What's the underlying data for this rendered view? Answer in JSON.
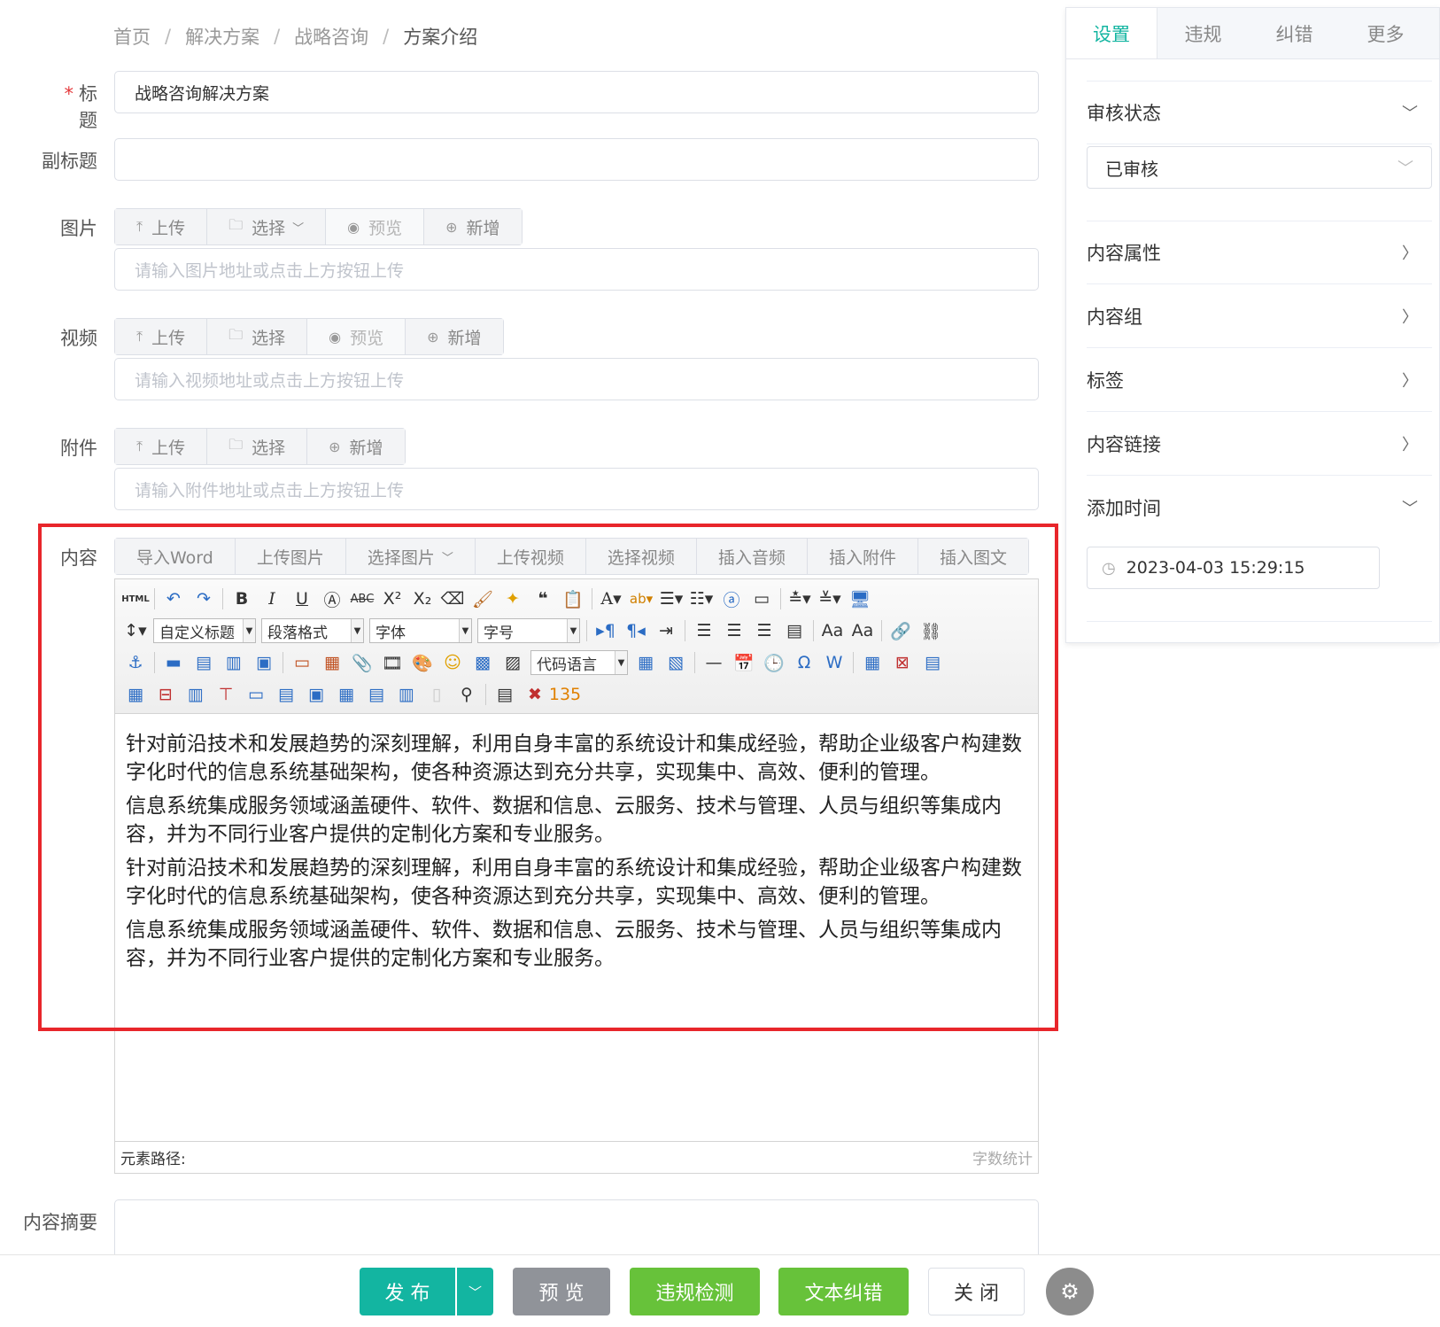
{
  "breadcrumb": [
    "首页",
    "解决方案",
    "战略咨询",
    "方案介绍"
  ],
  "breadcrumb_sep": "/",
  "form": {
    "title_required_mark": "*",
    "title_label": "标题",
    "title_value": "战略咨询解决方案",
    "subtitle_label": "副标题",
    "subtitle_value": "",
    "image_label": "图片",
    "image_buttons": {
      "upload": "上传",
      "select": "选择",
      "preview": "预览",
      "add": "新增"
    },
    "image_placeholder": "请输入图片地址或点击上方按钮上传",
    "video_label": "视频",
    "video_buttons": {
      "upload": "上传",
      "select": "选择",
      "preview": "预览",
      "add": "新增"
    },
    "video_placeholder": "请输入视频地址或点击上方按钮上传",
    "attach_label": "附件",
    "attach_buttons": {
      "upload": "上传",
      "select": "选择",
      "add": "新增"
    },
    "attach_placeholder": "请输入附件地址或点击上方按钮上传",
    "content_label": "内容",
    "summary_label": "内容摘要"
  },
  "content_actions": [
    "导入Word",
    "上传图片",
    "选择图片",
    "上传视频",
    "选择视频",
    "插入音频",
    "插入附件",
    "插入图文"
  ],
  "editor": {
    "selects": {
      "custom_heading": "自定义标题",
      "paragraph": "段落格式",
      "font": "字体",
      "size": "字号",
      "code_lang": "代码语言"
    },
    "html_btn": "HTML",
    "paragraphs": [
      "针对前沿技术和发展趋势的深刻理解，利用自身丰富的系统设计和集成经验，帮助企业级客户构建数字化时代的信息系统基础架构，使各种资源达到充分共享，实现集中、高效、便利的管理。",
      "信息系统集成服务领域涵盖硬件、软件、数据和信息、云服务、技术与管理、人员与组织等集成内容，并为不同行业客户提供的定制化方案和专业服务。",
      "针对前沿技术和发展趋势的深刻理解，利用自身丰富的系统设计和集成经验，帮助企业级客户构建数字化时代的信息系统基础架构，使各种资源达到充分共享，实现集中、高效、便利的管理。",
      "信息系统集成服务领域涵盖硬件、软件、数据和信息、云服务、技术与管理、人员与组织等集成内容，并为不同行业客户提供的定制化方案和专业服务。"
    ],
    "element_path": "元素路径:",
    "word_count": "字数统计"
  },
  "sidebar": {
    "tabs": [
      "设置",
      "违规",
      "纠错",
      "更多"
    ],
    "review_status_label": "审核状态",
    "review_status_value": "已审核",
    "content_props": "内容属性",
    "content_group": "内容组",
    "tags": "标签",
    "content_link": "内容链接",
    "add_time_label": "添加时间",
    "add_time_value": "2023-04-03 15:29:15"
  },
  "footer": {
    "publish": "发 布",
    "preview": "预 览",
    "violation_check": "违规检测",
    "text_correct": "文本纠错",
    "close": "关 闭"
  },
  "colors": {
    "primary": "#13b5a1",
    "preview_btn": "#909399",
    "green_btn": "#67c23a",
    "highlight": "#e8262b"
  }
}
